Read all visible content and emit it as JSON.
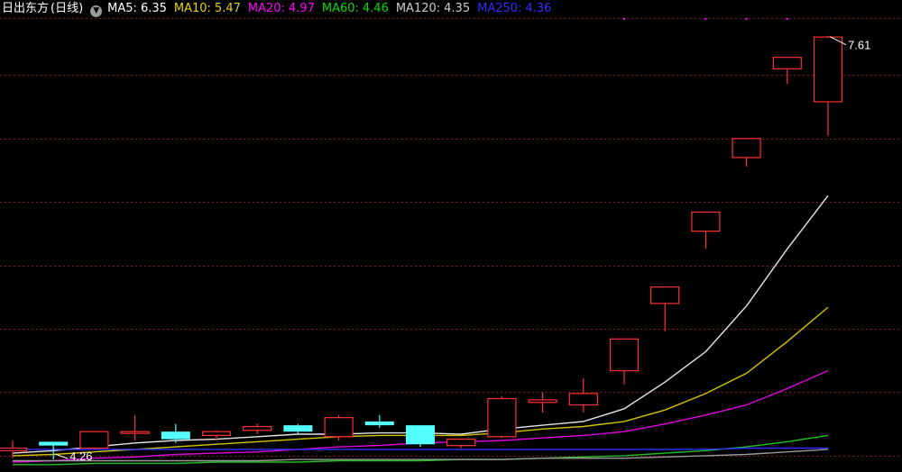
{
  "legend": {
    "stock_name": "日出东方",
    "period": "(日线)",
    "ma": [
      {
        "label": "MA5:",
        "value": "6.35",
        "color": "#ffffff"
      },
      {
        "label": "MA10:",
        "value": "5.47",
        "color": "#e8d200"
      },
      {
        "label": "MA20:",
        "value": "4.97",
        "color": "#ff00ff"
      },
      {
        "label": "MA60:",
        "value": "4.46",
        "color": "#00dd00"
      },
      {
        "label": "MA120:",
        "value": "4.35",
        "color": "#cccccc"
      },
      {
        "label": "MA250:",
        "value": "4.36",
        "color": "#2f2fff"
      }
    ]
  },
  "chart_data": {
    "type": "candlestick",
    "ylim": [
      4.2,
      7.75
    ],
    "high_label": "7.61",
    "low_label": "4.26",
    "grid_levels": [
      4.3,
      4.8,
      5.3,
      5.8,
      6.3,
      6.8,
      7.3,
      7.75
    ],
    "up_color": "#ff3030",
    "down_color": "#54ffff",
    "candles": [
      {
        "o": 4.34,
        "c": 4.36,
        "h": 4.42,
        "l": 4.28
      },
      {
        "o": 4.41,
        "c": 4.38,
        "h": 4.41,
        "l": 4.27
      },
      {
        "o": 4.36,
        "c": 4.49,
        "h": 4.49,
        "l": 4.35
      },
      {
        "o": 4.48,
        "c": 4.49,
        "h": 4.62,
        "l": 4.42
      },
      {
        "o": 4.49,
        "c": 4.43,
        "h": 4.55,
        "l": 4.4
      },
      {
        "o": 4.46,
        "c": 4.49,
        "h": 4.5,
        "l": 4.42
      },
      {
        "o": 4.5,
        "c": 4.53,
        "h": 4.55,
        "l": 4.47
      },
      {
        "o": 4.54,
        "c": 4.49,
        "h": 4.55,
        "l": 4.47
      },
      {
        "o": 4.45,
        "c": 4.6,
        "h": 4.62,
        "l": 4.42
      },
      {
        "o": 4.57,
        "c": 4.54,
        "h": 4.62,
        "l": 4.52
      },
      {
        "o": 4.54,
        "c": 4.39,
        "h": 4.54,
        "l": 4.37
      },
      {
        "o": 4.38,
        "c": 4.43,
        "h": 4.43,
        "l": 4.36
      },
      {
        "o": 4.45,
        "c": 4.75,
        "h": 4.77,
        "l": 4.44
      },
      {
        "o": 4.72,
        "c": 4.74,
        "h": 4.8,
        "l": 4.64
      },
      {
        "o": 4.7,
        "c": 4.79,
        "h": 4.91,
        "l": 4.64
      },
      {
        "o": 4.97,
        "c": 5.22,
        "h": 5.22,
        "l": 4.86
      },
      {
        "o": 5.5,
        "c": 5.63,
        "h": 5.63,
        "l": 5.28
      },
      {
        "o": 6.07,
        "c": 6.22,
        "h": 6.22,
        "l": 5.93
      },
      {
        "o": 6.65,
        "c": 6.8,
        "h": 6.8,
        "l": 6.58
      },
      {
        "o": 7.35,
        "c": 7.44,
        "h": 7.44,
        "l": 7.23
      },
      {
        "o": 7.09,
        "c": 7.6,
        "h": 7.61,
        "l": 6.82
      }
    ],
    "series": [
      {
        "name": "MA5",
        "color": "#e6e6e6",
        "values": [
          4.32,
          4.34,
          4.37,
          4.4,
          4.42,
          4.43,
          4.45,
          4.47,
          4.47,
          4.48,
          4.48,
          4.47,
          4.51,
          4.54,
          4.57,
          4.67,
          4.88,
          5.12,
          5.48,
          5.93,
          6.35
        ]
      },
      {
        "name": "MA10",
        "color": "#d4c400",
        "values": [
          4.3,
          4.31,
          4.33,
          4.35,
          4.37,
          4.39,
          4.41,
          4.43,
          4.45,
          4.46,
          4.46,
          4.46,
          4.48,
          4.51,
          4.53,
          4.57,
          4.66,
          4.79,
          4.95,
          5.2,
          5.47
        ]
      },
      {
        "name": "MA20",
        "color": "#e000e0",
        "values": [
          4.25,
          4.26,
          4.28,
          4.29,
          4.31,
          4.32,
          4.33,
          4.35,
          4.37,
          4.38,
          4.4,
          4.41,
          4.42,
          4.44,
          4.46,
          4.49,
          4.55,
          4.62,
          4.7,
          4.83,
          4.97
        ]
      },
      {
        "name": "MA60",
        "color": "#22c022",
        "values": [
          4.23,
          4.23,
          4.24,
          4.24,
          4.24,
          4.25,
          4.25,
          4.25,
          4.26,
          4.26,
          4.26,
          4.27,
          4.27,
          4.28,
          4.29,
          4.3,
          4.32,
          4.34,
          4.37,
          4.41,
          4.46
        ]
      },
      {
        "name": "MA120",
        "color": "#9a9a9a",
        "values": [
          4.26,
          4.26,
          4.26,
          4.26,
          4.26,
          4.26,
          4.26,
          4.27,
          4.27,
          4.27,
          4.27,
          4.27,
          4.27,
          4.28,
          4.28,
          4.28,
          4.29,
          4.3,
          4.31,
          4.33,
          4.35
        ]
      },
      {
        "name": "MA250",
        "color": "#2f2fff",
        "values": [
          4.35,
          4.35,
          4.35,
          4.35,
          4.35,
          4.35,
          4.35,
          4.35,
          4.35,
          4.35,
          4.35,
          4.35,
          4.35,
          4.35,
          4.35,
          4.35,
          4.35,
          4.35,
          4.36,
          4.36,
          4.36
        ]
      }
    ]
  }
}
